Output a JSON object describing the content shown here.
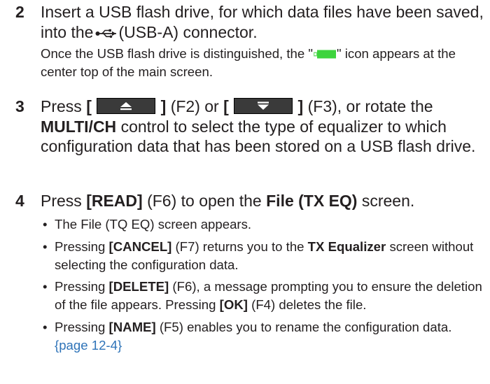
{
  "steps": [
    {
      "number": "2",
      "main": {
        "t1": "Insert a USB flash drive, for which data files have been saved, into the",
        "t2": "(USB-A) connector."
      },
      "sub": {
        "t1": "Once the USB flash drive is distinguished, the \"",
        "t2": "\" icon appears at the center top of the main screen."
      }
    },
    {
      "number": "3",
      "main": {
        "t1": "Press",
        "bracket_open": "[",
        "bracket_close": "]",
        "f2": "(F2) or",
        "f3": "(F3), or rotate the",
        "control": "MULTI/CH",
        "t2": "control to select the type of equalizer to which configuration data that has been stored on a USB flash drive."
      }
    },
    {
      "number": "4",
      "main": {
        "t1": "Press",
        "key": "[READ]",
        "t2": "(F6) to open the",
        "screen": "File (TX EQ)",
        "t3": "screen."
      },
      "bullets": [
        {
          "t1": "The File (TQ EQ) screen appears."
        },
        {
          "t1": "Pressing",
          "key": "[CANCEL]",
          "t2": "(F7) returns you to the",
          "screen": "TX Equalizer",
          "t3": "screen without selecting the configuration data."
        },
        {
          "t1": "Pressing",
          "key": "[DELETE]",
          "t2": "(F6), a message prompting you to ensure the deletion of the file appears. Pressing",
          "key2": "[OK]",
          "t3": "(F4) deletes the file."
        },
        {
          "t1": "Pressing",
          "key": "[NAME]",
          "t2": "(F5) enables you to rename the configuration data.",
          "link": "{page 12-4}"
        }
      ]
    }
  ],
  "bullet_char": "•",
  "icons": {
    "usb_connector": "usb-symbol-icon",
    "usb_drive_status": "usb-drive-icon",
    "key_up": "triangle-up-icon",
    "key_down": "triangle-down-icon"
  },
  "colors": {
    "text": "#231f20",
    "link": "#2e73b8",
    "usb_indicator": "#3dd43d",
    "key_face": "#3a3a3a"
  }
}
